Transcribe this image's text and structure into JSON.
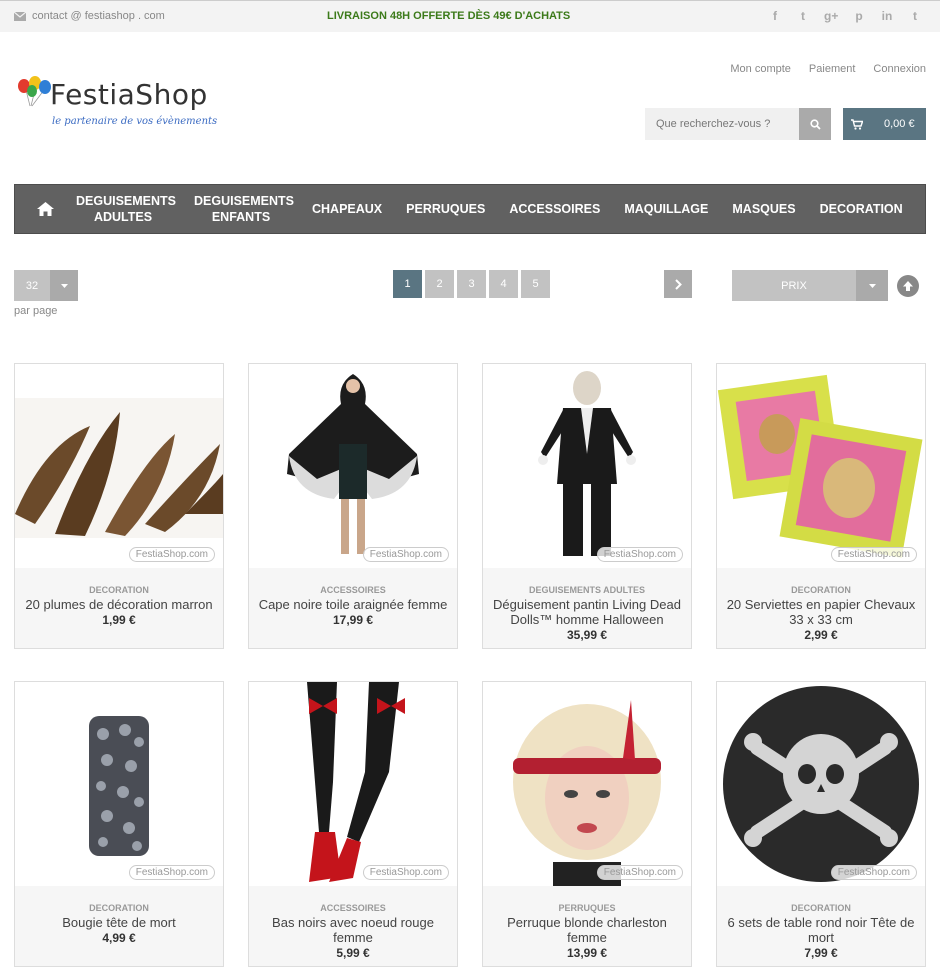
{
  "topbar": {
    "contact": "contact @ festiashop . com",
    "promo": "LIVRAISON 48H OFFERTE DÈS 49€ D'ACHATS",
    "social": [
      "f",
      "t",
      "g+",
      "p",
      "in",
      "t"
    ]
  },
  "logo": {
    "name": "FestiaShop",
    "tagline": "le partenaire de vos évènements"
  },
  "account": {
    "my_account": "Mon compte",
    "payment": "Paiement",
    "login": "Connexion"
  },
  "search": {
    "placeholder": "Que recherchez-vous ?"
  },
  "cart": {
    "amount": "0,00 €"
  },
  "nav": {
    "items": [
      "DEGUISEMENTS ADULTES",
      "DEGUISEMENTS ENFANTS",
      "CHAPEAUX",
      "PERRUQUES",
      "ACCESSOIRES",
      "MAQUILLAGE",
      "MASQUES",
      "DECORATION"
    ]
  },
  "toolbar": {
    "per_page_value": "32",
    "per_page_label": "par page",
    "pages": [
      "1",
      "2",
      "3",
      "4",
      "5"
    ],
    "current_page": "1",
    "sort_value": "PRIX"
  },
  "watermark": "FestiaShop.com",
  "products": [
    {
      "category": "DECORATION",
      "name": "20 plumes de décoration marron",
      "price": "1,99 €"
    },
    {
      "category": "ACCESSOIRES",
      "name": "Cape noire toile araignée femme",
      "price": "17,99 €"
    },
    {
      "category": "DEGUISEMENTS ADULTES",
      "name": "Déguisement pantin Living Dead Dolls™ homme Halloween",
      "price": "35,99 €"
    },
    {
      "category": "DECORATION",
      "name": "20 Serviettes en papier Chevaux 33 x 33 cm",
      "price": "2,99 €"
    },
    {
      "category": "DECORATION",
      "name": "Bougie tête de mort",
      "price": "4,99 €"
    },
    {
      "category": "ACCESSOIRES",
      "name": "Bas noirs avec noeud rouge femme",
      "price": "5,99 €"
    },
    {
      "category": "PERRUQUES",
      "name": "Perruque blonde charleston femme",
      "price": "13,99 €"
    },
    {
      "category": "DECORATION",
      "name": "6 sets de table rond noir Tête de mort",
      "price": "7,99 €"
    }
  ],
  "colors": {
    "accent": "#5a7582",
    "nav_bg": "#616161",
    "promo_green": "#3c7a1a"
  }
}
